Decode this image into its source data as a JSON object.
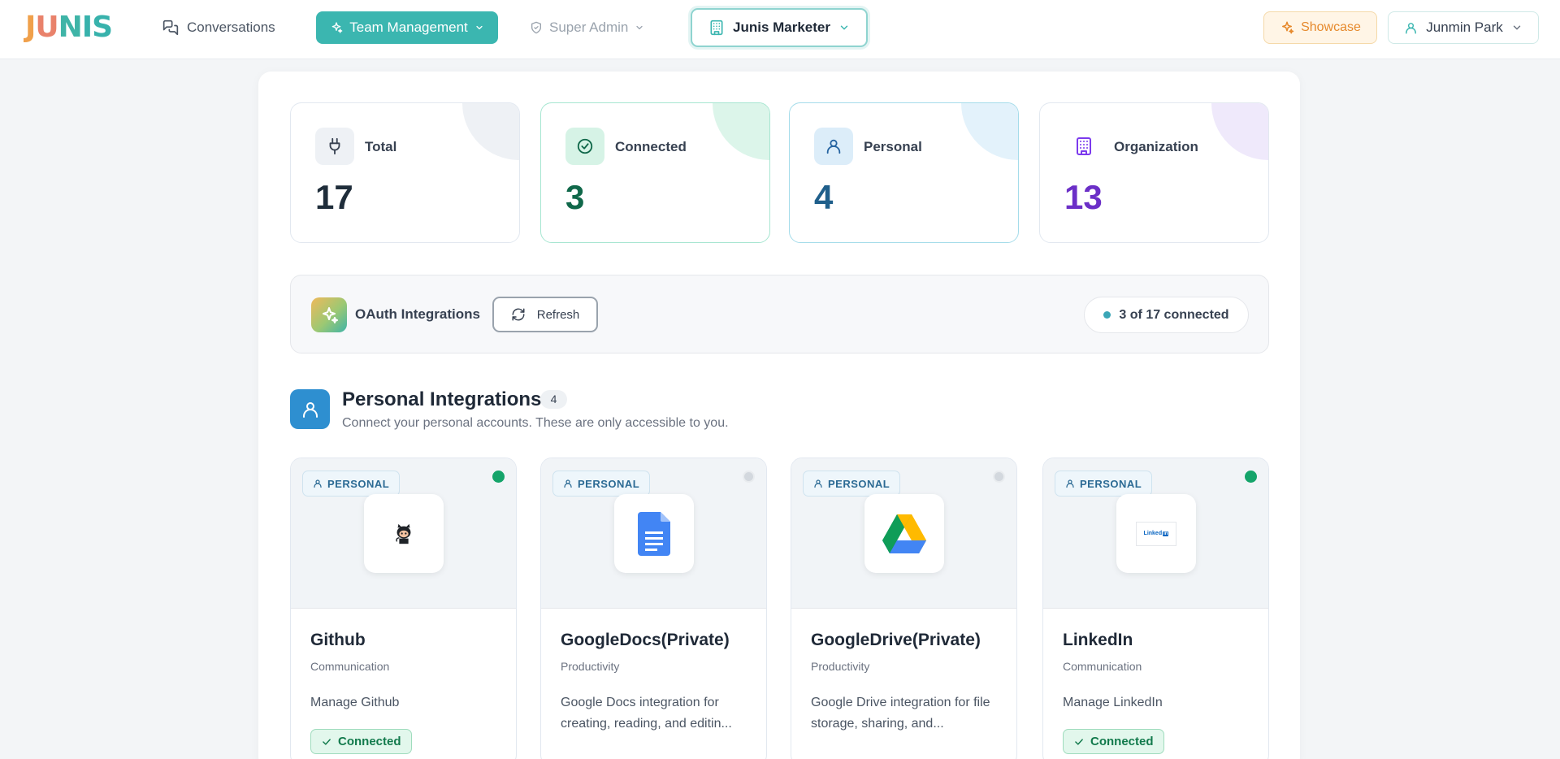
{
  "nav": {
    "logo": "JUNIS",
    "conversations": "Conversations",
    "team_management": "Team Management",
    "super_admin": "Super Admin",
    "org": "Junis Marketer",
    "showcase": "Showcase",
    "user": "Junmin Park"
  },
  "stats": [
    {
      "label": "Total",
      "value": "17",
      "color": "#1f2d3a"
    },
    {
      "label": "Connected",
      "value": "3",
      "color": "#10684a"
    },
    {
      "label": "Personal",
      "value": "4",
      "color": "#1f5f8b"
    },
    {
      "label": "Organization",
      "value": "13",
      "color": "#6b2fc7"
    }
  ],
  "oauth": {
    "title": "OAuth Integrations",
    "refresh": "Refresh",
    "summary": "3 of 17 connected"
  },
  "personal": {
    "title": "Personal Integrations",
    "count": "4",
    "subtitle": "Connect your personal accounts. These are only accessible to you."
  },
  "cards": [
    {
      "badge": "PERSONAL",
      "name": "Github",
      "category": "Communication",
      "description": "Manage Github",
      "connected": true,
      "status_label": "Connected",
      "icon": "github-icon"
    },
    {
      "badge": "PERSONAL",
      "name": "GoogleDocs(Private)",
      "category": "Productivity",
      "description": "Google Docs integration for creating, reading, and editin...",
      "connected": false,
      "icon": "google-docs-icon"
    },
    {
      "badge": "PERSONAL",
      "name": "GoogleDrive(Private)",
      "category": "Productivity",
      "description": "Google Drive integration for file storage, sharing, and...",
      "connected": false,
      "icon": "google-drive-icon"
    },
    {
      "badge": "PERSONAL",
      "name": "LinkedIn",
      "category": "Communication",
      "description": "Manage LinkedIn",
      "connected": true,
      "status_label": "Connected",
      "icon": "linkedin-icon",
      "logo_text": "Linked"
    }
  ]
}
